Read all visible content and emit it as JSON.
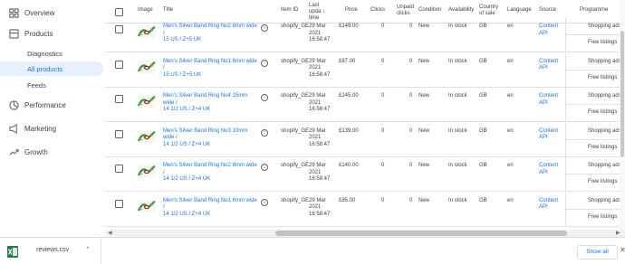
{
  "sidebar": {
    "items": [
      {
        "label": "Overview",
        "icon": "grid-icon"
      },
      {
        "label": "Products",
        "icon": "products-icon"
      },
      {
        "label": "Performance",
        "icon": "performance-icon"
      },
      {
        "label": "Marketing",
        "icon": "megaphone-icon"
      },
      {
        "label": "Growth",
        "icon": "trending-up-icon"
      }
    ],
    "sub_items": [
      {
        "label": "Diagnostics"
      },
      {
        "label": "All products",
        "active": true
      },
      {
        "label": "Feeds"
      }
    ]
  },
  "table": {
    "headers": {
      "image": "Image",
      "title": "Title",
      "item_id": "Item ID",
      "last_update": [
        "Last",
        "upda",
        "time"
      ],
      "price": "Price",
      "clicks": "Clicks",
      "unpaid_clicks": [
        "Unpaid",
        "clicks"
      ],
      "condition": "Condition",
      "availability": "Availability",
      "country": [
        "Country",
        "of sale"
      ],
      "language": "Language",
      "source": "Source",
      "programme": "Programme"
    },
    "sort_arrow": "↓",
    "rows": [
      {
        "title": [
          "Men's Silver Band Ring No2 8mm wide /",
          "15 US / Z+5 UK"
        ],
        "item_id": "shopify_GE",
        "date": [
          "29 Mar",
          "2021",
          "16:58:47"
        ],
        "price": "£149.00",
        "clicks": "0",
        "unpaid": "0",
        "condition": "New",
        "availability": "In stock",
        "country": "GB",
        "language": "en",
        "source": [
          "Content",
          "API"
        ],
        "programmes": [
          "Shopping ads",
          "Free listings"
        ]
      },
      {
        "title": [
          "Men's Silver Band Ring No1 6mm wide /",
          "15 US / Z+5 UK"
        ],
        "item_id": "shopify_GE",
        "date": [
          "29 Mar",
          "2021",
          "16:58:47"
        ],
        "price": "£87.00",
        "clicks": "0",
        "unpaid": "0",
        "condition": "New",
        "availability": "In stock",
        "country": "GB",
        "language": "en",
        "source": [
          "Content",
          "API"
        ],
        "programmes": [
          "Shopping ads",
          "Free listings"
        ]
      },
      {
        "title": [
          "Men's Silver Band Ring No4 15mm wide /",
          "14 1/2 US / Z+4 UK"
        ],
        "item_id": "shopify_GE",
        "date": [
          "29 Mar",
          "2021",
          "16:58:47"
        ],
        "price": "£245.00",
        "clicks": "0",
        "unpaid": "0",
        "condition": "New",
        "availability": "In stock",
        "country": "GB",
        "language": "en",
        "source": [
          "Content",
          "API"
        ],
        "programmes": [
          "Shopping ads",
          "Free listings"
        ]
      },
      {
        "title": [
          "Men's Silver Band Ring No3 10mm wide /",
          "14 1/2 US / Z+4 UK"
        ],
        "item_id": "shopify_GE",
        "date": [
          "29 Mar",
          "2021",
          "16:58:47"
        ],
        "price": "£139.00",
        "clicks": "0",
        "unpaid": "0",
        "condition": "New",
        "availability": "In stock",
        "country": "GB",
        "language": "en",
        "source": [
          "Content",
          "API"
        ],
        "programmes": [
          "Shopping ads",
          "Free listings"
        ]
      },
      {
        "title": [
          "Men's Silver Band Ring No2 8mm wide /",
          "14 1/2 US / Z+4 UK"
        ],
        "item_id": "shopify_GE",
        "date": [
          "29 Mar",
          "2021",
          "16:58:47"
        ],
        "price": "£140.00",
        "clicks": "0",
        "unpaid": "0",
        "condition": "New",
        "availability": "In stock",
        "country": "GB",
        "language": "en",
        "source": [
          "Content",
          "API"
        ],
        "programmes": [
          "Shopping ads",
          "Free listings"
        ]
      },
      {
        "title": [
          "Men's Silver Band Ring No1 6mm wide /",
          "14 1/2 US / Z+4 UK"
        ],
        "item_id": "shopify_GE",
        "date": [
          "29 Mar",
          "2021",
          "16:58:47"
        ],
        "price": "£85.00",
        "clicks": "0",
        "unpaid": "0",
        "condition": "New",
        "availability": "In stock",
        "country": "GB",
        "language": "en",
        "source": [
          "Content",
          "API"
        ],
        "programmes": [
          "Shopping ads",
          "Free listings"
        ]
      }
    ]
  },
  "downloads": {
    "file_name": "reviews.csv",
    "file_icon": "excel-file-icon",
    "show_all": "Show all"
  },
  "colors": {
    "accent": "#1a73e8",
    "active_bg": "#e8f0fe"
  }
}
